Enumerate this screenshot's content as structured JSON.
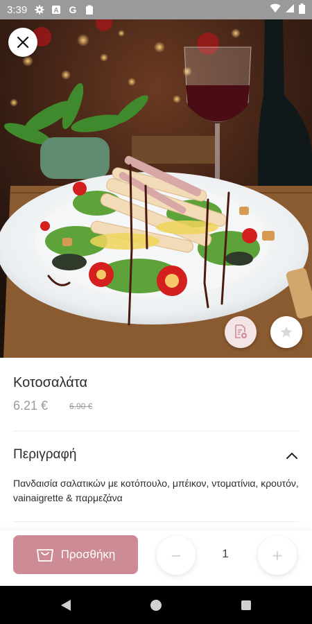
{
  "status_bar": {
    "time": "3:39",
    "left_icons": [
      "gear-icon",
      "a-icon",
      "g-icon",
      "clipboard-icon"
    ],
    "right_icons": [
      "wifi-icon",
      "signal-icon",
      "battery-icon"
    ]
  },
  "hero": {
    "image": "salad-photo"
  },
  "product": {
    "name": "Κοτοσαλάτα",
    "price": "6.21 €",
    "old_price": "6.90 €"
  },
  "description": {
    "header": "Περιγραφή",
    "text": "Πανδαισία σαλατικών με κοτόπουλο, μπέικον, ντοματίνια, κρουτόν, vainaigrette & παρμεζάνα"
  },
  "actions": {
    "add_label": "Προσθήκη",
    "quantity": "1",
    "minus": "−",
    "plus": "+"
  },
  "colors": {
    "accent": "#cc8b95",
    "accent_light": "#f3e4e6",
    "status_bar": "#9a9a9a"
  }
}
